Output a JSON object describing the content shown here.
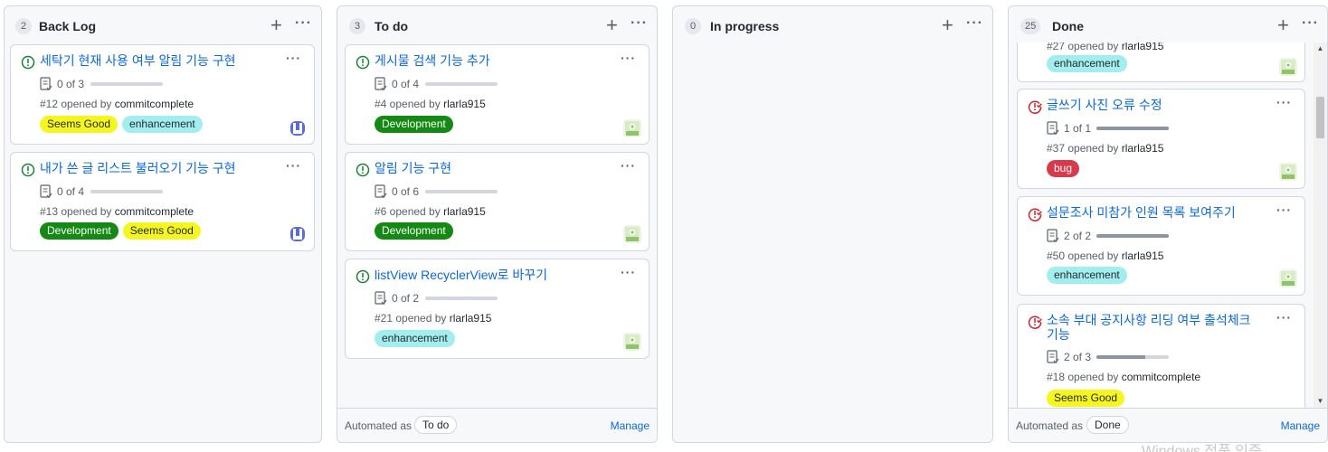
{
  "colors": {
    "accent": "#0969da",
    "open_icon": "#1a7f37",
    "closed_icon": "#cf222e",
    "seems_good_bg": "#f5f51f",
    "enhancement_bg": "#a2eeef",
    "development_bg": "#148a14",
    "bug_bg": "#d73a4a"
  },
  "icons": {
    "add": "+",
    "more": "···",
    "scroll_up": "▲",
    "scroll_down": "▼"
  },
  "columns": [
    {
      "count": "2",
      "title": "Back Log",
      "cards": [
        {
          "state": "open",
          "title": "세탁기 현재 사용 여부 알림 기능 구현",
          "tasks": "0 of 3",
          "progress": 0,
          "meta_prefix": "#12 opened by ",
          "user": "commitcomplete",
          "labels": [
            "Seems Good",
            "enhancement"
          ],
          "avatar": "commitcomplete-avatar"
        },
        {
          "state": "open",
          "title": "내가 쓴 글 리스트 불러오기 기능 구현",
          "tasks": "0 of 4",
          "progress": 0,
          "meta_prefix": "#13 opened by ",
          "user": "commitcomplete",
          "labels": [
            "Development",
            "Seems Good"
          ],
          "avatar": "commitcomplete-avatar"
        }
      ]
    },
    {
      "count": "3",
      "title": "To do",
      "cards": [
        {
          "state": "open",
          "title": "게시물 검색 기능 추가",
          "tasks": "0 of 4",
          "progress": 0,
          "meta_prefix": "#4 opened by ",
          "user": "rlarla915",
          "labels": [
            "Development"
          ],
          "avatar": "rlarla915-avatar"
        },
        {
          "state": "open",
          "title": "알림 기능 구현",
          "tasks": "0 of 6",
          "progress": 0,
          "meta_prefix": "#6 opened by ",
          "user": "rlarla915",
          "labels": [
            "Development"
          ],
          "avatar": "rlarla915-avatar"
        },
        {
          "state": "open",
          "title": "listView RecyclerView로 바꾸기",
          "tasks": "0 of 2",
          "progress": 0,
          "meta_prefix": "#21 opened by ",
          "user": "rlarla915",
          "labels": [
            "enhancement"
          ],
          "avatar": "rlarla915-avatar"
        }
      ],
      "automated_label": "Automated as",
      "automated_value": "To do",
      "manage": "Manage"
    },
    {
      "count": "0",
      "title": "In progress",
      "cards": []
    },
    {
      "count": "25",
      "title": "Done",
      "cards": [
        {
          "state": "closed",
          "title": "",
          "tasks": "",
          "progress": 0,
          "meta_prefix": "#27 opened by ",
          "user": "rlarla915",
          "labels": [
            "enhancement"
          ],
          "avatar": "rlarla915-avatar"
        },
        {
          "state": "closed",
          "title": "글쓰기 사진 오류 수정",
          "tasks": "1 of 1",
          "progress": 1,
          "meta_prefix": "#37 opened by ",
          "user": "rlarla915",
          "labels": [
            "bug"
          ],
          "avatar": "rlarla915-avatar"
        },
        {
          "state": "closed",
          "title": "설문조사 미참가 인원 목록 보여주기",
          "tasks": "2 of 2",
          "progress": 1,
          "meta_prefix": "#50 opened by ",
          "user": "rlarla915",
          "labels": [
            "enhancement"
          ],
          "avatar": "rlarla915-avatar"
        },
        {
          "state": "closed",
          "title": "소속 부대 공지사항 리딩 여부 출석체크",
          "title_line2": "기능",
          "tasks": "2 of 3",
          "progress": 0.67,
          "meta_prefix": "#18 opened by ",
          "user": "commitcomplete",
          "labels": [
            "Seems Good"
          ],
          "avatar": "commitcomplete-avatar"
        }
      ],
      "automated_label": "Automated as",
      "automated_value": "Done",
      "manage": "Manage"
    }
  ],
  "watermark": "Windows 정품 인증"
}
